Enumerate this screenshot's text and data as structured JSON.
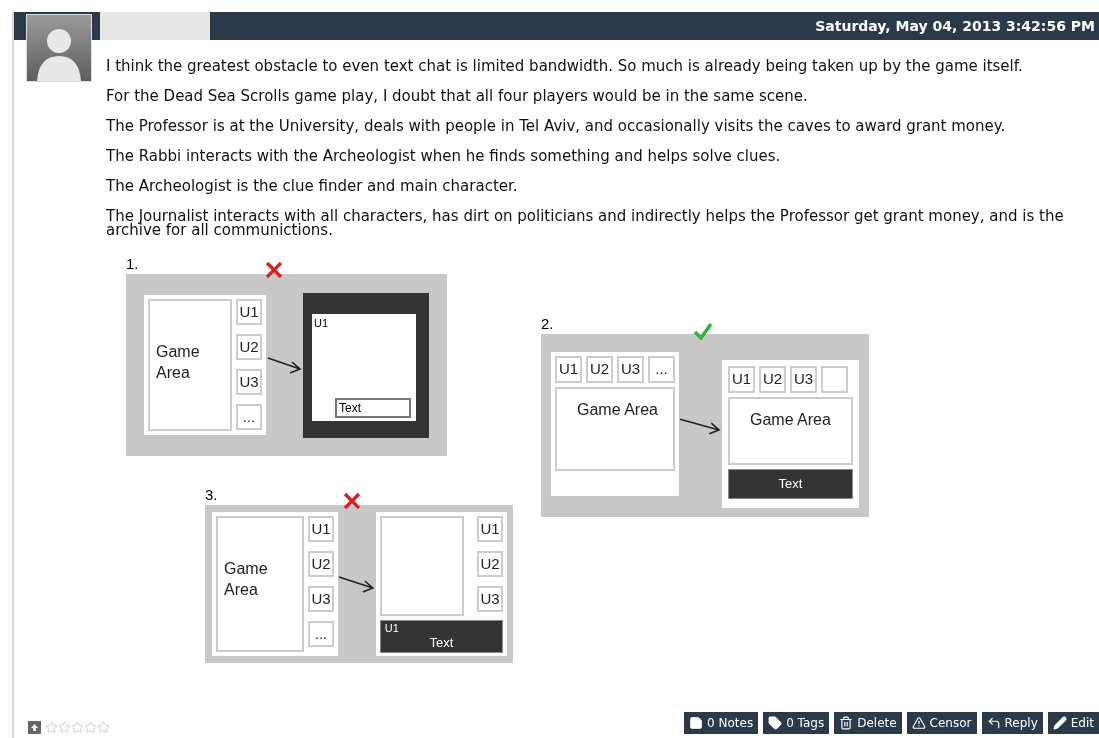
{
  "post": {
    "date": "Saturday, May 04, 2013 3:42:56 PM",
    "paragraphs": [
      "I think the greatest obstacle to even text chat is limited bandwidth.  So much is already being taken up by the game itself.",
      "For the Dead Sea Scrolls game play, I doubt that all four players would be in the same scene.",
      "The Professor is at the University, deals with people in Tel Aviv, and occasionally visits the caves to award grant money.",
      "The Rabbi interacts with the Archeologist when he finds something and helps solve clues.",
      "The Archeologist is the clue finder and main character.",
      "The Journalist interacts with all characters, has dirt on politicians and indirectly helps the Professor get grant money, and is the archive for all communictions."
    ],
    "figure": {
      "diagrams": [
        {
          "label": "1.",
          "approved": false,
          "kind": "side",
          "game_area": "Game Area",
          "users": [
            "U1",
            "U2",
            "U3",
            "..."
          ],
          "chat_users": [
            "U1"
          ],
          "chat_input": "Text"
        },
        {
          "label": "2.",
          "approved": true,
          "kind": "top",
          "game_area": "Game Area",
          "users": [
            "U1",
            "U2",
            "U3",
            "..."
          ],
          "chat_users": [
            "U1",
            "U2",
            "U3"
          ],
          "chat_game_area": "Game Area",
          "chat_input": "Text"
        },
        {
          "label": "3.",
          "approved": false,
          "kind": "bottom",
          "game_area": "Game Area",
          "users": [
            "U1",
            "U2",
            "U3",
            "..."
          ],
          "chat_users": [
            "U1",
            "U2",
            "U3"
          ],
          "chat_speaker": "U1",
          "chat_input": "Text"
        }
      ]
    },
    "rating": {
      "stars": 0
    },
    "actions": [
      {
        "kind": "notes",
        "label": "0 Notes"
      },
      {
        "kind": "tags",
        "label": "0 Tags"
      },
      {
        "kind": "delete",
        "label": "Delete"
      },
      {
        "kind": "censor",
        "label": "Censor"
      },
      {
        "kind": "reply",
        "label": "Reply"
      },
      {
        "kind": "edit",
        "label": "Edit"
      }
    ]
  }
}
